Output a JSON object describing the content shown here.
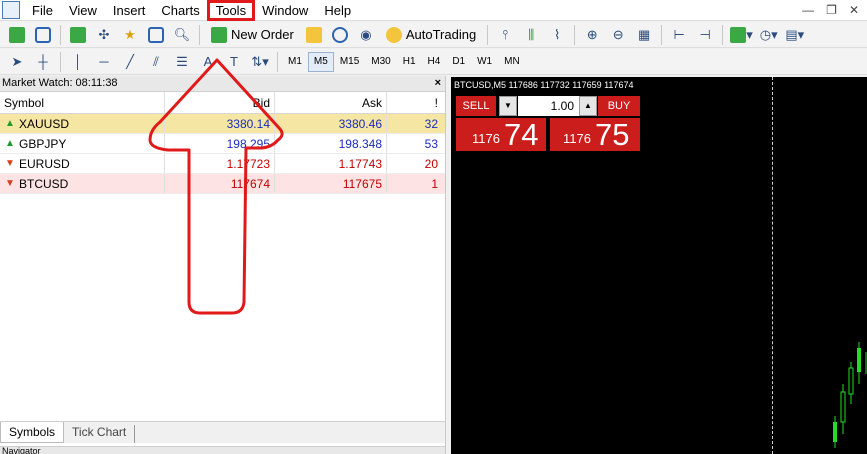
{
  "menu": {
    "items": [
      "File",
      "View",
      "Insert",
      "Charts",
      "Tools",
      "Window",
      "Help"
    ],
    "highlighted": "Tools"
  },
  "toolbar": {
    "new_order_label": "New Order",
    "autotrading_label": "AutoTrading",
    "timeframes": [
      "M1",
      "M5",
      "M15",
      "M30",
      "H1",
      "H4",
      "D1",
      "W1",
      "MN"
    ],
    "active_timeframe": "M5"
  },
  "market_watch": {
    "title": "Market Watch: 08:11:38",
    "close": "×",
    "columns": {
      "symbol": "Symbol",
      "bid": "Bid",
      "ask": "Ask",
      "spread": "!"
    },
    "rows": [
      {
        "symbol": "XAUUSD",
        "bid": "3380.14",
        "ask": "3380.46",
        "spread": "32",
        "direction": "up"
      },
      {
        "symbol": "GBPJPY",
        "bid": "198.295",
        "ask": "198.348",
        "spread": "53",
        "direction": "up"
      },
      {
        "symbol": "EURUSD",
        "bid": "1.17723",
        "ask": "1.17743",
        "spread": "20",
        "direction": "down"
      },
      {
        "symbol": "BTCUSD",
        "bid": "117674",
        "ask": "117675",
        "spread": "1",
        "direction": "down"
      }
    ],
    "tabs": [
      "Symbols",
      "Tick Chart"
    ],
    "active_tab": "Symbols",
    "navigator_label": "Navigator"
  },
  "chart": {
    "title": "BTCUSD,M5  117686 117732 117659 117674",
    "sell_label": "SELL",
    "buy_label": "BUY",
    "lot_size": "1.00",
    "sell_price_small": "1176",
    "sell_price_big": "74",
    "buy_price_small": "1176",
    "buy_price_big": "75"
  },
  "colors": {
    "accent_red": "#cc1d1d",
    "annotation_red": "#e01a1a",
    "selected_row": "#f5e7a3",
    "up_green": "#1f9a2c",
    "down_red": "#d0401a"
  },
  "icons": {
    "up": "▲",
    "down": "▼",
    "chevron_down": "▾"
  }
}
